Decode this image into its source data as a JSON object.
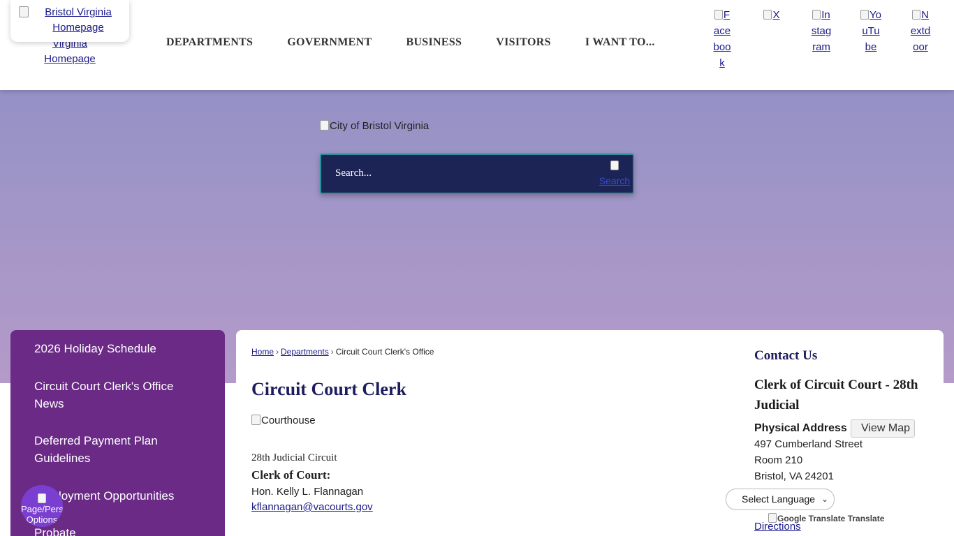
{
  "header": {
    "logo_alt": "Bristol Virginia Homepage",
    "logo_alt_under": "Virginia Homepage",
    "nav": [
      "DEPARTMENTS",
      "GOVERNMENT",
      "BUSINESS",
      "VISITORS",
      "I WANT TO..."
    ],
    "social": {
      "facebook": "Facebook",
      "x": "X",
      "instagram": "Instagram",
      "youtube": "YouTube",
      "nextdoor": "Nextdoor"
    }
  },
  "hero": {
    "logo_alt": "City of Bristol Virginia",
    "search_placeholder": "Search...",
    "search_button_alt": "Search"
  },
  "sidebar": {
    "items": [
      "2026 Holiday Schedule",
      "Circuit Court Clerk's Office News",
      "Deferred Payment Plan Guidelines",
      "Employment Opportunities",
      "Probate"
    ],
    "chat_alt": "Page/Person Options"
  },
  "breadcrumb": {
    "home": "Home",
    "departments": "Departments",
    "current": "Circuit Court Clerk's Office",
    "sep": "›"
  },
  "main": {
    "title": "Circuit Court Clerk",
    "image_alt": "Courthouse",
    "circuit": "28th Judicial Circuit",
    "clerk_label": "Clerk of Court:",
    "clerk_name": "Hon. Kelly L. Flannagan",
    "clerk_email": "kflannagan@vacourts.gov"
  },
  "contact": {
    "heading": "Contact Us",
    "org": "Clerk of Circuit Court - 28th Judicial",
    "physical_label": "Physical Address",
    "view_map": "View Map",
    "address": [
      "497 Cumberland Street",
      "Room 210",
      "Bristol, VA 24201"
    ],
    "directions": "Directions"
  },
  "translate": {
    "select_label": "Select Language",
    "credit_alt": "Google Translate",
    "credit_text": "Translate"
  },
  "colors": {
    "sidebar_bg": "#6a2a86",
    "search_bg": "#1c2456",
    "title": "#1c1c5e",
    "link": "#1a1a8a"
  }
}
